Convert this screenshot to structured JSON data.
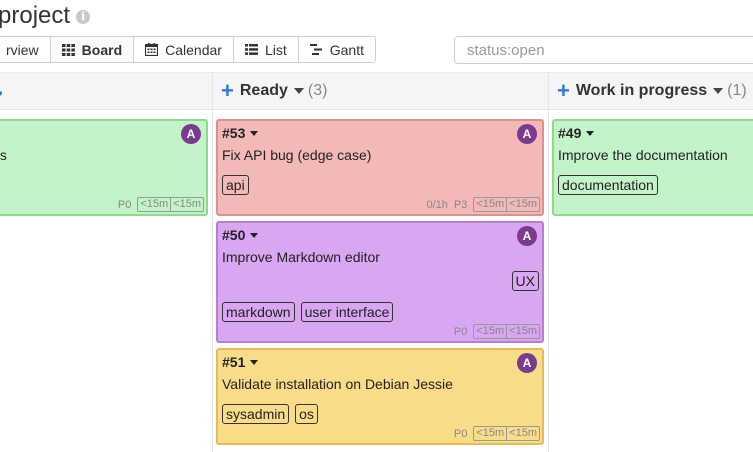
{
  "header": {
    "title": "project",
    "info_icon": "info-icon"
  },
  "views": [
    {
      "label": "rview",
      "icon": ""
    },
    {
      "label": "Board",
      "icon": "grid-icon",
      "active": true
    },
    {
      "label": "Calendar",
      "icon": "calendar-icon"
    },
    {
      "label": "List",
      "icon": "list-icon"
    },
    {
      "label": "Gantt",
      "icon": "gantt-icon"
    }
  ],
  "search": {
    "value": "status:open"
  },
  "columns": [
    {
      "name": "Ready",
      "count": "(3)"
    },
    {
      "name": "Work in progress",
      "count": "(1)"
    }
  ],
  "cards": {
    "left": {
      "title": "ts",
      "priority": "P0",
      "est": [
        "<15m",
        "<15m"
      ],
      "avatar": "A"
    },
    "c53": {
      "id": "#53",
      "title": "Fix API bug (edge case)",
      "tags": [
        "api"
      ],
      "time": "0/1h",
      "priority": "P3",
      "est": [
        "<15m",
        "<15m"
      ],
      "avatar": "A"
    },
    "c50": {
      "id": "#50",
      "title": "Improve Markdown editor",
      "tags": [
        "markdown",
        "user interface"
      ],
      "tag_right": "UX",
      "priority": "P0",
      "est": [
        "<15m",
        "<15m"
      ],
      "avatar": "A"
    },
    "c51": {
      "id": "#51",
      "title": "Validate installation on Debian Jessie",
      "tags": [
        "sysadmin",
        "os"
      ],
      "priority": "P0",
      "est": [
        "<15m",
        "<15m"
      ],
      "avatar": "A"
    },
    "c49": {
      "id": "#49",
      "title": "Improve the documentation",
      "tags": [
        "documentation"
      ],
      "avatar": "A"
    }
  },
  "colors": {
    "green": "#c3f4c9",
    "red": "#f3b8b8",
    "purple": "#d9a6f2",
    "yellow": "#f8dc87",
    "accent": "#2f7ad8",
    "avatar": "#7b3b8c"
  }
}
